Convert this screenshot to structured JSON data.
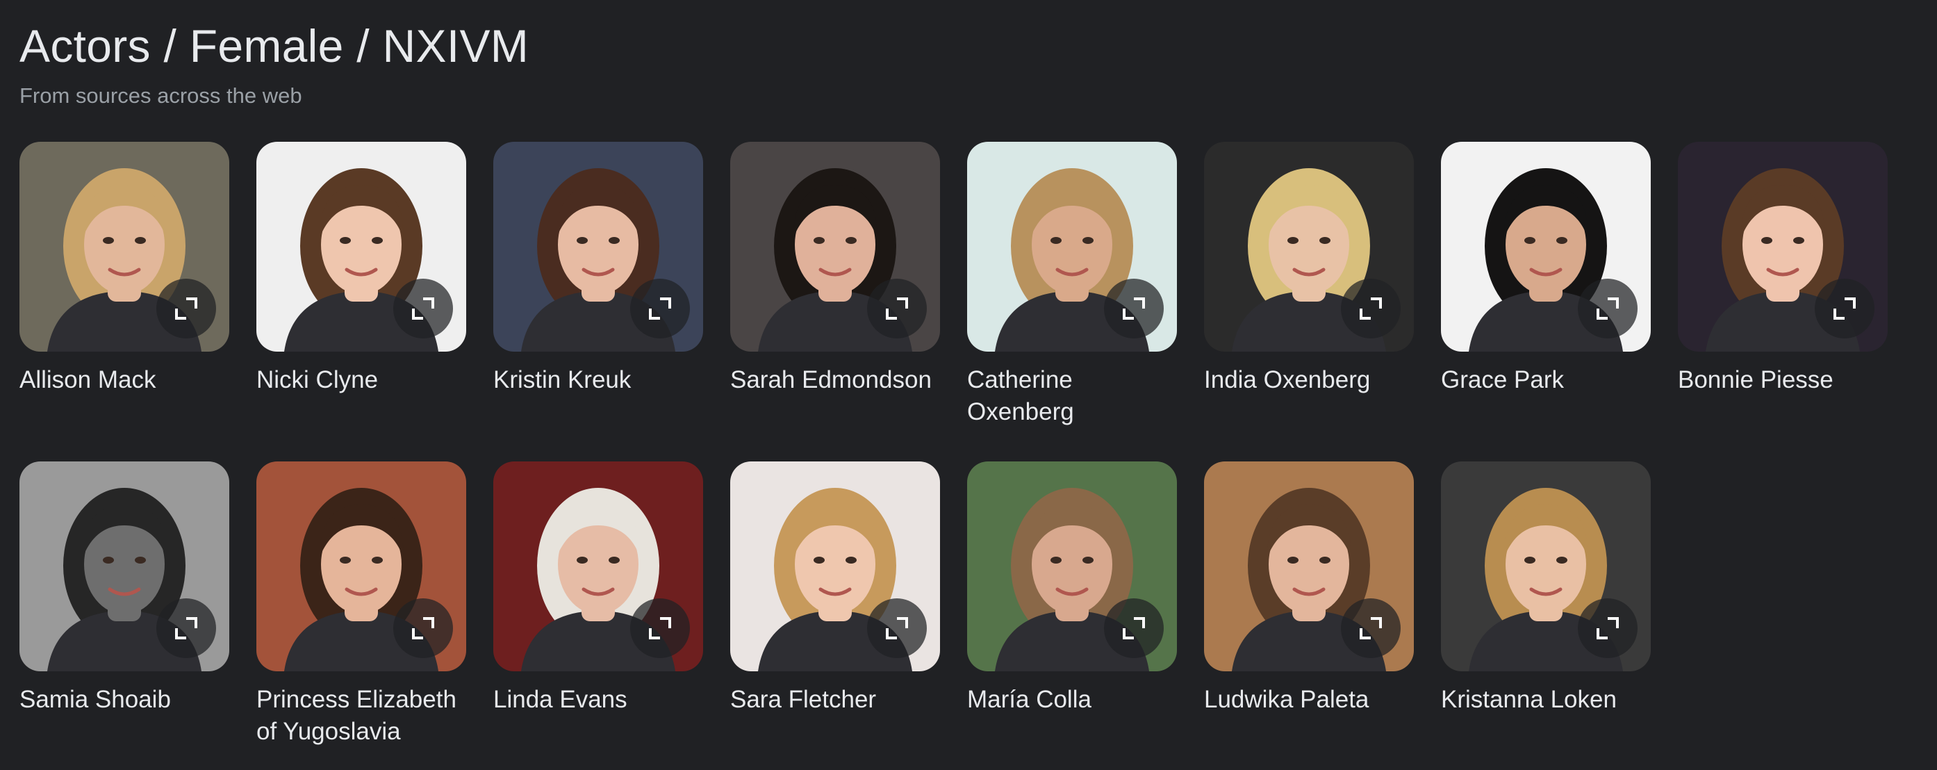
{
  "header": {
    "title": "Actors / Female / NXIVM",
    "subtitle": "From sources across the web"
  },
  "people": [
    {
      "name": "Allison Mack",
      "bg": "#6e6a5c",
      "skin": "#e2b79a",
      "hair": "#c9a46a"
    },
    {
      "name": "Nicki Clyne",
      "bg": "#efefef",
      "skin": "#efc6ae",
      "hair": "#5a3a25"
    },
    {
      "name": "Kristin Kreuk",
      "bg": "#3c4459",
      "skin": "#e7bba3",
      "hair": "#4a2c20"
    },
    {
      "name": "Sarah Edmondson",
      "bg": "#4a4545",
      "skin": "#e0b19a",
      "hair": "#1c1714"
    },
    {
      "name": "Catherine Oxenberg",
      "bg": "#d9e8e6",
      "skin": "#d9a98a",
      "hair": "#b8925e"
    },
    {
      "name": "India Oxenberg",
      "bg": "#2b2b2b",
      "skin": "#e8c2a6",
      "hair": "#d8bf7c"
    },
    {
      "name": "Grace Park",
      "bg": "#f2f2f2",
      "skin": "#d8a98c",
      "hair": "#151414"
    },
    {
      "name": "Bonnie Piesse",
      "bg": "#2a2430",
      "skin": "#efc4ad",
      "hair": "#5a3b26"
    },
    {
      "name": "Samia Shoaib",
      "bg": "#9a9a9a",
      "skin": "#6e6e6e",
      "hair": "#262626"
    },
    {
      "name": "Princess Elizabeth of Yugoslavia",
      "bg": "#a3533a",
      "skin": "#e5b59a",
      "hair": "#3b2418"
    },
    {
      "name": "Linda Evans",
      "bg": "#6e1f1f",
      "skin": "#e6bca6",
      "hair": "#e7e3dc"
    },
    {
      "name": "Sara Fletcher",
      "bg": "#eae4e2",
      "skin": "#efc7ae",
      "hair": "#c79a5c"
    },
    {
      "name": "María Colla",
      "bg": "#55744a",
      "skin": "#d8a88e",
      "hair": "#8a6848"
    },
    {
      "name": "Ludwika Paleta",
      "bg": "#ab7a4f",
      "skin": "#e3b69c",
      "hair": "#5a3d28"
    },
    {
      "name": "Kristanna Loken",
      "bg": "#3a3a3a",
      "skin": "#e9c0a4",
      "hair": "#b88d50"
    }
  ],
  "icons": {
    "expand": "expand-icon"
  }
}
